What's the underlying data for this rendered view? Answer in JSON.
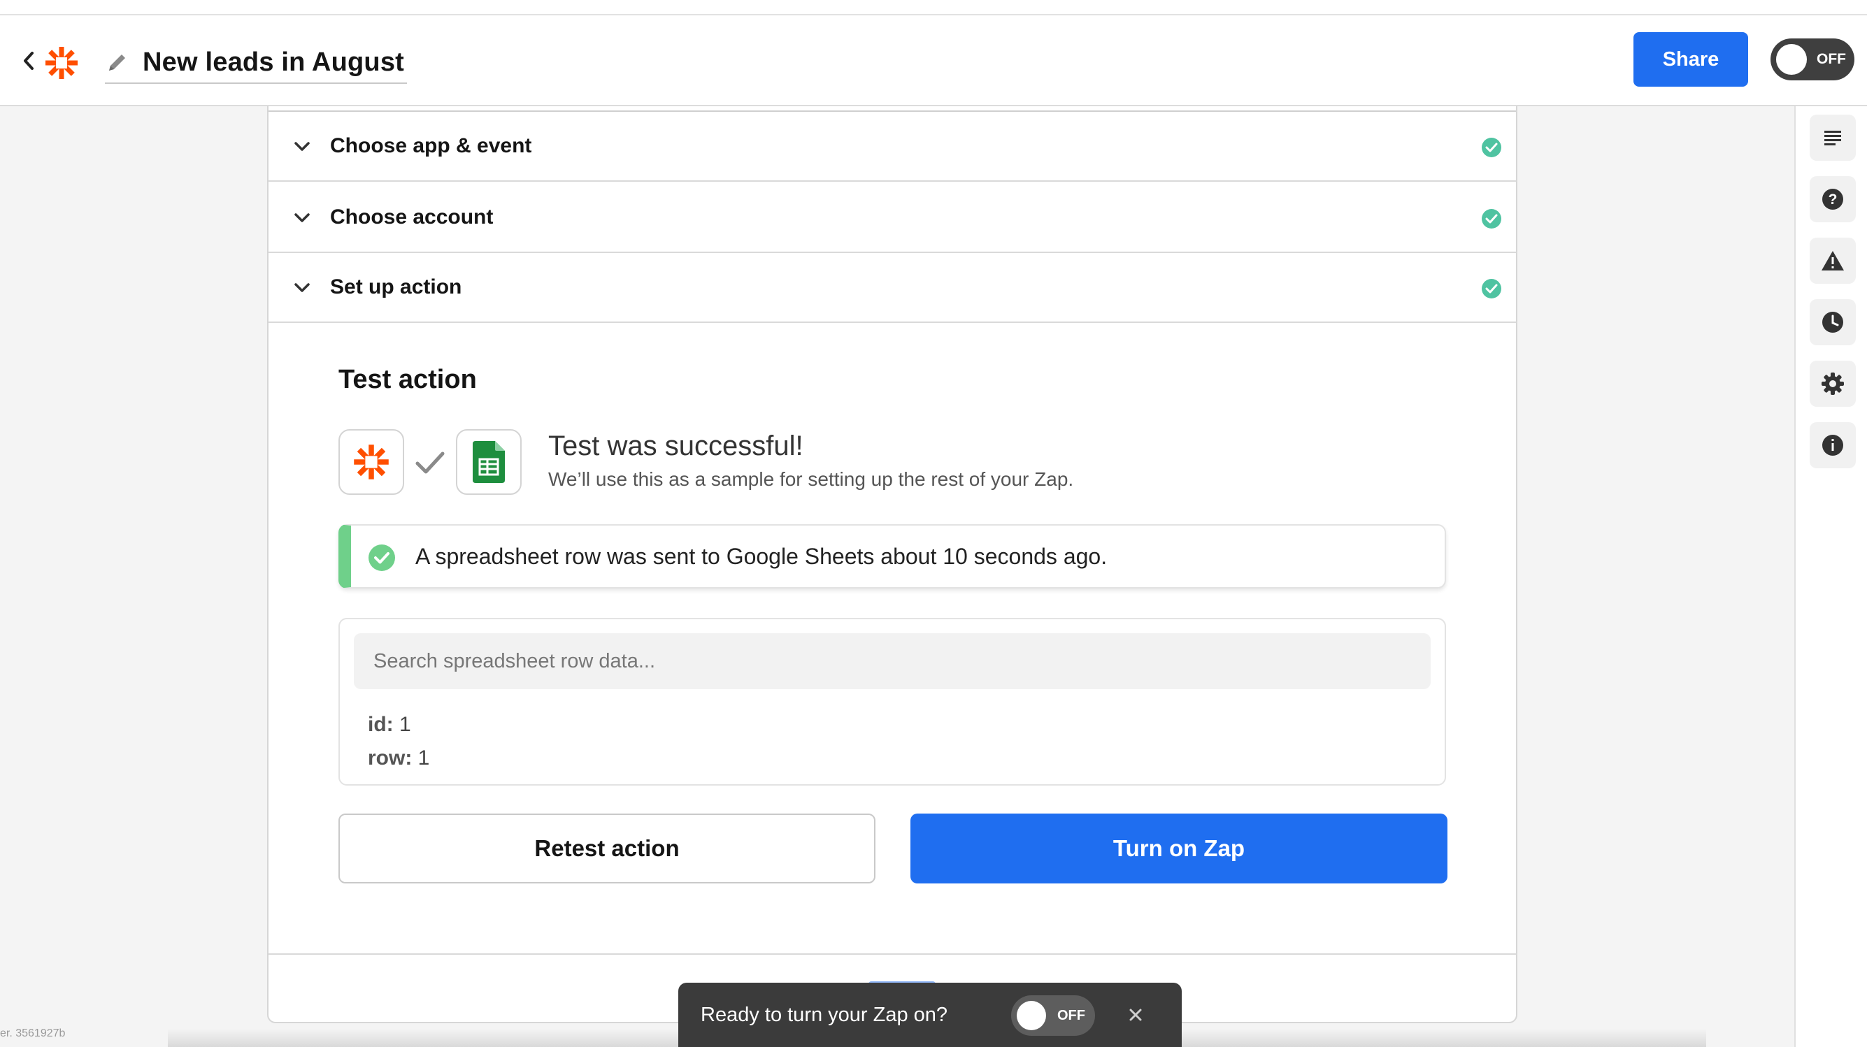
{
  "header": {
    "zap_title": "New leads in August",
    "share_label": "Share",
    "toggle_label": "OFF"
  },
  "steps": [
    {
      "label": "Choose app & event",
      "status": "complete"
    },
    {
      "label": "Choose account",
      "status": "complete"
    },
    {
      "label": "Set up action",
      "status": "complete"
    }
  ],
  "test_action": {
    "title": "Test action",
    "success_title": "Test was successful!",
    "success_subtitle": "We’ll use this as a sample for setting up the rest of your Zap.",
    "alert_text": "A spreadsheet row was sent to Google Sheets about 10 seconds ago.",
    "search_placeholder": "Search spreadsheet row data...",
    "fields": [
      {
        "key": "id:",
        "value": "1"
      },
      {
        "key": "row:",
        "value": "1"
      }
    ],
    "retest_label": "Retest action",
    "turn_on_label": "Turn on Zap"
  },
  "toast": {
    "text": "Ready to turn your Zap on?",
    "toggle_label": "OFF"
  },
  "footer": {
    "version": "er. 3561927b"
  },
  "colors": {
    "primary": "#1f6ef0",
    "success": "#6fd08a",
    "check_teal": "#4fc3a1",
    "zapier_orange": "#ff4f00",
    "sheets_green": "#1e8e3e"
  },
  "rail_icons": [
    "list-icon",
    "help-icon",
    "warning-icon",
    "history-icon",
    "settings-icon",
    "info-icon"
  ]
}
